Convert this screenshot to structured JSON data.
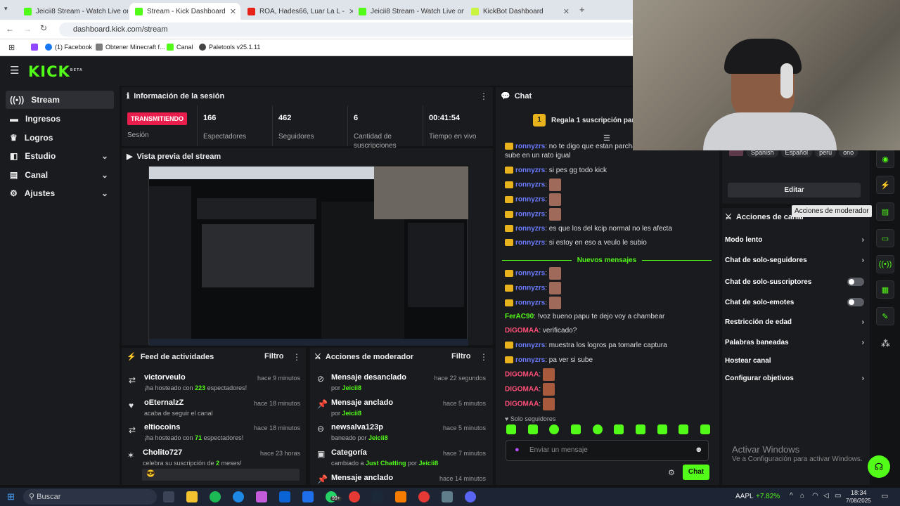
{
  "browser": {
    "tabs": [
      "Jeicii8 Stream - Watch Live on K",
      "Stream - Kick Dashboard",
      "ROA, Hades66, Luar La L - ",
      "Jeicii8 Stream - Watch Live on K",
      "KickBot Dashboard"
    ],
    "url": "dashboard.kick.com/stream",
    "bookmarks": [
      "(1) Facebook",
      "Obtener Minecraft f...",
      "Canal",
      "Paletools v25.1.11"
    ]
  },
  "header": {
    "logo": "KICK",
    "logo_sup": "BETA"
  },
  "sidebar": {
    "items": [
      {
        "label": "Stream",
        "icon": "stream-icon"
      },
      {
        "label": "Ingresos",
        "icon": "money-icon"
      },
      {
        "label": "Logros",
        "icon": "trophy-icon"
      },
      {
        "label": "Estudio",
        "icon": "studio-icon"
      },
      {
        "label": "Canal",
        "icon": "channel-icon"
      },
      {
        "label": "Ajustes",
        "icon": "gear-icon"
      }
    ]
  },
  "session": {
    "title": "Información de la sesión",
    "live_badge": "TRANSMITIENDO",
    "live_label": "Sesión",
    "stats": [
      {
        "value": "166",
        "label": "Espectadores"
      },
      {
        "value": "462",
        "label": "Seguidores"
      },
      {
        "value": "6",
        "label": "Cantidad de suscripciones"
      },
      {
        "value": "00:41:54",
        "label": "Tiempo en vivo"
      }
    ]
  },
  "preview": {
    "title": "Vista previa del stream"
  },
  "activity": {
    "title": "Feed de actividades",
    "filter": "Filtro",
    "items": [
      {
        "name": "victorveulo",
        "pre": "¡ha hosteado con ",
        "num": "223",
        "post": " espectadores!",
        "time": "hace 9 minutos"
      },
      {
        "name": "oEternalzZ",
        "pre": "acaba de seguir el canal",
        "num": "",
        "post": "",
        "time": "hace 18 minutos"
      },
      {
        "name": "eltiocoins",
        "pre": "¡ha hosteado con ",
        "num": "71",
        "post": " espectadores!",
        "time": "hace 18 minutos"
      },
      {
        "name": "Cholito727",
        "pre": "celebra su suscripción de ",
        "num": "2",
        "post": " meses!",
        "time": "hace 23 horas"
      }
    ]
  },
  "modactions": {
    "title": "Acciones de moderador",
    "filter": "Filtro",
    "items": [
      {
        "title": "Mensaje desanclado",
        "pre": "por ",
        "who": "Jeicii8",
        "time": "hace 22 segundos"
      },
      {
        "title": "Mensaje anclado",
        "pre": "por ",
        "who": "Jeicii8",
        "time": "hace 5 minutos"
      },
      {
        "title": "newsalva123p",
        "pre": "baneado por ",
        "who": "Jeicii8",
        "time": "hace 5 minutos"
      },
      {
        "title": "Categoría",
        "pre": "cambiado a ",
        "who": "Just Chatting",
        "extra": " por ",
        "who2": "Jeicii8",
        "time": "hace 7 minutos"
      },
      {
        "title": "Mensaje anclado",
        "pre": "",
        "who": "",
        "time": "hace 14 minutos"
      }
    ]
  },
  "chat": {
    "title": "Chat",
    "gift_badge": "1",
    "gift": "Regala 1 suscripción para to",
    "new_messages": "Nuevos mensajes",
    "followers_only": "Solo seguidores",
    "placeholder": "Enviar un mensaje",
    "send": "Chat",
    "messages": [
      {
        "user": "ronnyzrs",
        "text": ": no te digo que estan parchand",
        "crown": true
      },
      {
        "user": "",
        "text": "sube en un rato igual",
        "crown": false
      },
      {
        "user": "ronnyzrs",
        "text": ": si pes gg todo kick",
        "crown": true
      },
      {
        "user": "ronnyzrs",
        "text": ":",
        "crown": true,
        "emote": true
      },
      {
        "user": "ronnyzrs",
        "text": ":",
        "crown": true,
        "emote": true
      },
      {
        "user": "ronnyzrs",
        "text": ":",
        "crown": true,
        "emote": true
      },
      {
        "user": "ronnyzrs",
        "text": ": es que los del kcip normal no les afecta",
        "crown": true
      },
      {
        "user": "ronnyzrs",
        "text": ": si estoy en eso a veulo le subio",
        "crown": true
      }
    ],
    "messages2": [
      {
        "user": "ronnyzrs",
        "text": ":",
        "crown": true,
        "emote": true,
        "c": ""
      },
      {
        "user": "ronnyzrs",
        "text": ":",
        "crown": true,
        "emote": true,
        "c": ""
      },
      {
        "user": "ronnyzrs",
        "text": ":",
        "crown": true,
        "emote": true,
        "c": ""
      },
      {
        "user": "FerAC90",
        "text": ": !voz bueno papu te dejo voy a chambear",
        "crown": false,
        "c": "g"
      },
      {
        "user": "DIGOMAA",
        "text": ": verificado?",
        "crown": false,
        "c": "r"
      },
      {
        "user": "ronnyzrs",
        "text": ": muestra los logros pa tomarle captura",
        "crown": true,
        "c": ""
      },
      {
        "user": "ronnyzrs",
        "text": ": pa ver si sube",
        "crown": true,
        "c": ""
      },
      {
        "user": "DIGOMAA",
        "text": ":",
        "crown": false,
        "emote": true,
        "c": "r"
      },
      {
        "user": "DIGOMAA",
        "text": ":",
        "crown": false,
        "emote": true,
        "c": "r"
      },
      {
        "user": "DIGOMAA",
        "text": ":",
        "crown": false,
        "emote": true,
        "c": "r"
      }
    ]
  },
  "right": {
    "tags": [
      "Spanish",
      "Español",
      "peru",
      "ono"
    ],
    "edit": "Editar",
    "mod_title": "Acciones de canal",
    "tooltip": "Acciones de moderador",
    "items": [
      {
        "label": "Modo lento",
        "type": "arrow"
      },
      {
        "label": "Chat de solo-seguidores",
        "type": "arrow"
      },
      {
        "label": "Chat de solo-suscriptores",
        "type": "toggle"
      },
      {
        "label": "Chat de solo-emotes",
        "type": "toggle"
      },
      {
        "label": "Restricción de edad",
        "type": "arrow"
      },
      {
        "label": "Palabras baneadas",
        "type": "arrow"
      },
      {
        "label": "Hostear canal",
        "type": "none"
      },
      {
        "label": "Configurar objetivos",
        "type": "arrow"
      }
    ],
    "activate": "Activar Windows",
    "activate_sub": "Ve a Configuración para activar Windows."
  },
  "taskbar": {
    "search": "Buscar",
    "ticker": "AAPL",
    "ticker_change": "+7.82%",
    "time": "18:34",
    "date": "7/08/2025",
    "badge": "99+"
  },
  "colors": {
    "accent": "#53fc18",
    "live": "#e91e4d"
  }
}
